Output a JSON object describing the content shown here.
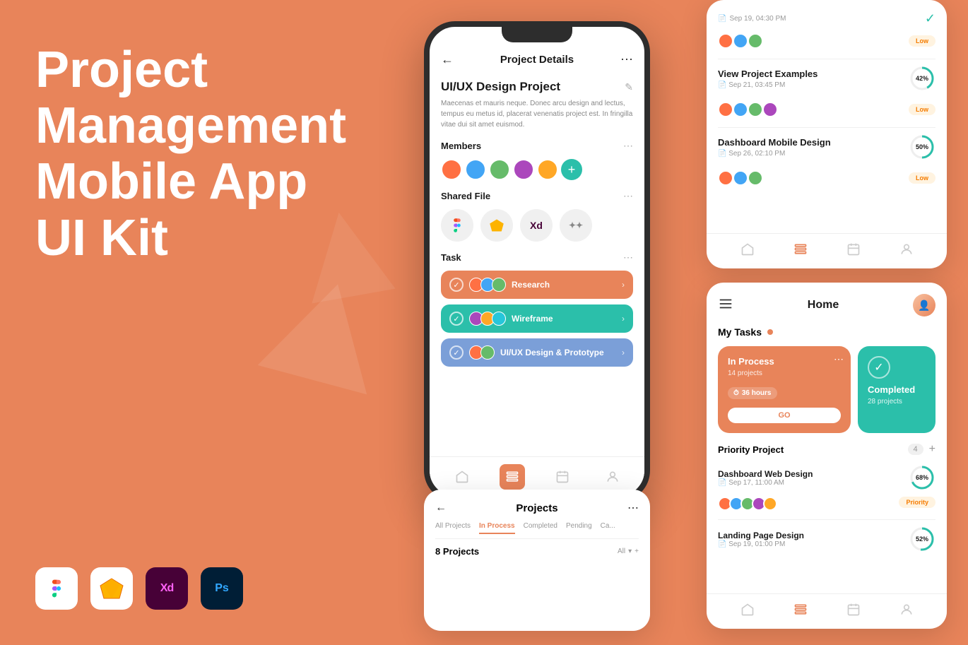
{
  "background_color": "#E8845A",
  "left": {
    "title_line1": "Project",
    "title_line2": "Management",
    "title_line3": "Mobile App UI Kit",
    "tools": [
      "Figma",
      "Sketch",
      "XD",
      "Ps"
    ]
  },
  "phone_center": {
    "header": {
      "back": "←",
      "title": "Project Details",
      "menu": "⋯"
    },
    "project": {
      "name": "UI/UX Design Project",
      "description": "Maecenas et mauris neque. Donec arcu design and lectus, tempus eu metus id, placerat venenatis project est. In fringilla vitae dui sit amet euismod."
    },
    "members_section": {
      "title": "Members",
      "add_label": "+"
    },
    "shared_file_section": {
      "title": "Shared File"
    },
    "task_section": {
      "title": "Task",
      "tasks": [
        {
          "label": "Research",
          "color": "#E8845A"
        },
        {
          "label": "Wireframe",
          "color": "#2BBFAA"
        },
        {
          "label": "UI/UX Design & Prototype",
          "color": "#7B9FD8"
        }
      ]
    },
    "nav": {
      "items": [
        "home",
        "list",
        "calendar",
        "user"
      ]
    }
  },
  "right_top": {
    "items": [
      {
        "title": "View Project Examples",
        "date": "Sep 21, 03:45 PM",
        "badge": "Low",
        "progress": 42
      },
      {
        "title": "Dashboard Mobile Design",
        "date": "Sep 26, 02:10 PM",
        "badge": "Low",
        "progress": 50
      }
    ]
  },
  "right_home": {
    "header": {
      "title": "Home"
    },
    "my_tasks_label": "My Tasks",
    "cards": {
      "in_process": {
        "status": "In Process",
        "count": "14 projects",
        "hours": "36 hours",
        "go_label": "GO"
      },
      "completed": {
        "status": "Completed",
        "count": "28 projects"
      }
    },
    "priority_label": "Priority Project",
    "priority_count": "4",
    "projects": [
      {
        "name": "Dashboard Web Design",
        "date": "Sep 17, 11:00 AM",
        "badge": "68%",
        "progress": 68
      },
      {
        "name": "Landing Page Design",
        "date": "Sep 19, 01:00 PM",
        "badge": "52%",
        "progress": 52
      }
    ],
    "nav": [
      "home",
      "list",
      "calendar",
      "user"
    ]
  },
  "bottom_phone": {
    "header": {
      "back": "←",
      "title": "Projects",
      "menu": "⋯"
    },
    "tabs": [
      "All Projects",
      "In Process",
      "Completed",
      "Pending",
      "Ca..."
    ],
    "active_tab": "In Process",
    "count_label": "8 Projects",
    "filter_label": "All"
  }
}
